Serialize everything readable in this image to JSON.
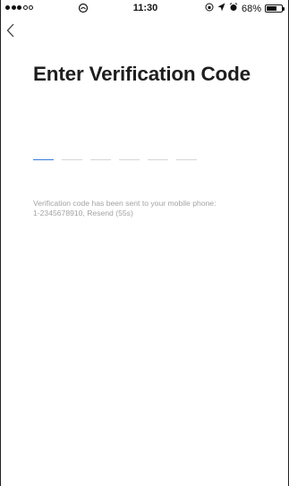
{
  "status_bar": {
    "time": "11:30",
    "battery_percent": "68%",
    "battery_level": 0.68,
    "signal_bars": 3,
    "signal_total": 5,
    "icons": [
      "wifi-icon",
      "location-icon",
      "alarm-icon",
      "orientation-lock-icon",
      "battery-icon"
    ]
  },
  "header": {
    "back_icon": "chevron-left-icon"
  },
  "page": {
    "title": "Enter Verification Code"
  },
  "code_input": {
    "length": 6,
    "active_index": 0,
    "value": ""
  },
  "hint": {
    "message": "Verification code has been sent to your mobile phone:",
    "phone": "1-2345678910,",
    "resend_label": "Resend (55s)"
  },
  "colors": {
    "accent": "#3b7bdc",
    "title": "#1e1e1e",
    "hint": "#a3a3a3"
  }
}
